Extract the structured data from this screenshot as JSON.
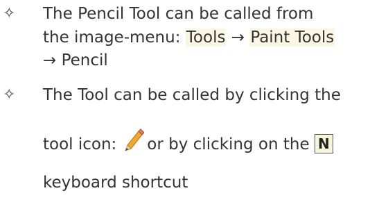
{
  "bullets": [
    {
      "line1": "The Pencil Tool can be called from",
      "line2_prefix": "the image-menu:",
      "menu_tools": "Tools",
      "arrow1": "→",
      "menu_paint_tools": "Paint Tools",
      "arrow2": "→",
      "menu_pencil": "Pencil"
    },
    {
      "line1": "The Tool can be called by clicking the",
      "line2_prefix": "tool icon:",
      "line2_suffix": "or by clicking on the",
      "shortcut_key": "N",
      "line3": "keyboard shortcut"
    }
  ],
  "icons": {
    "bullet": "four-pointed-star-icon",
    "tool": "pencil-icon"
  },
  "colors": {
    "menu_highlight": "#fbf6e3",
    "key_background": "#f3f6d8",
    "text": "#333333"
  }
}
